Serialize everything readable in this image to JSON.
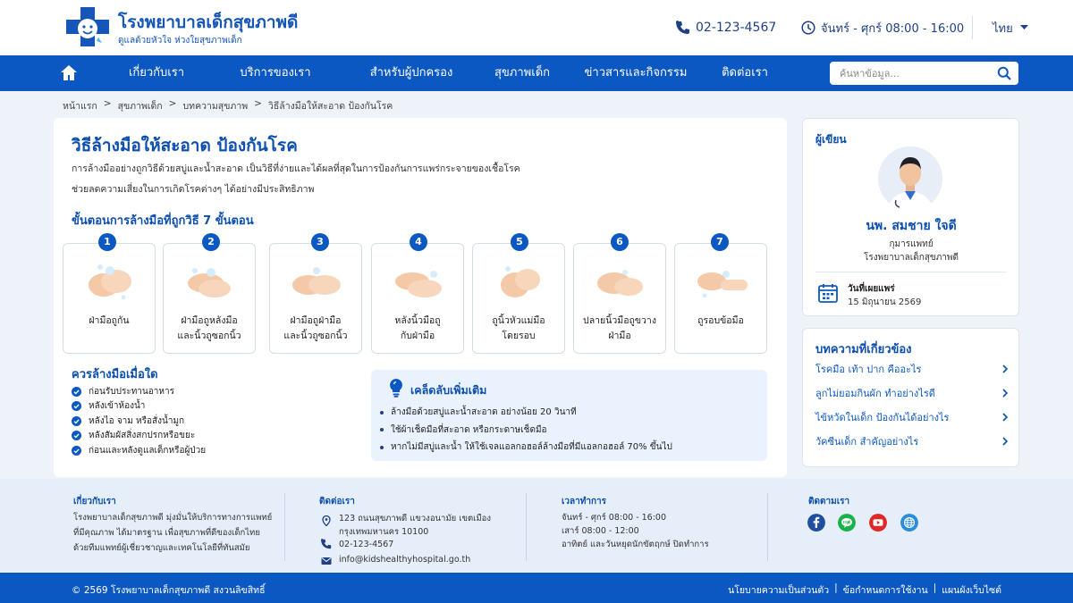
{
  "header": {
    "logo_title": "โรงพยาบาลเด็กสุขภาพดี",
    "logo_subtitle": "ดูแลด้วยหัวใจ ห่วงใยสุขภาพเด็ก",
    "phone": "02-123-4567",
    "hours": "จันทร์ - ศุกร์ 08:00 - 16:00",
    "language": "ไทย"
  },
  "nav": {
    "items": [
      "เกี่ยวกับเรา",
      "บริการของเรา",
      "สำหรับผู้ปกครอง",
      "สุขภาพเด็ก",
      "ข่าวสารและกิจกรรม",
      "ติดต่อเรา"
    ],
    "search_placeholder": "ค้นหาข้อมูล..."
  },
  "breadcrumb": [
    "หน้าแรก",
    "สุขภาพเด็ก",
    "บทความสุขภาพ",
    "วิธีล้างมือให้สะอาด ป้องกันโรค"
  ],
  "article": {
    "title": "วิธีล้างมือให้สะอาด ป้องกันโรค",
    "intro_line1": "การล้างมืออย่างถูกวิธีด้วยสบู่และน้ำสะอาด เป็นวิธีที่ง่ายและได้ผลที่สุดในการป้องกันการแพร่กระจายของเชื้อโรค",
    "intro_line2": "ช่วยลดความเสี่ยงในการเกิดโรคต่างๆ ได้อย่างมีประสิทธิภาพ",
    "steps_heading": "ขั้นตอนการล้างมือที่ถูกวิธี 7 ขั้นตอน",
    "steps": [
      {
        "num": "1",
        "line1": "ฝ่ามือถูกัน",
        "line2": ""
      },
      {
        "num": "2",
        "line1": "ฝ่ามือถูหลังมือ",
        "line2": "และนิ้วถูซอกนิ้ว"
      },
      {
        "num": "3",
        "line1": "ฝ่ามือถูฝ่ามือ",
        "line2": "และนิ้วถูซอกนิ้ว"
      },
      {
        "num": "4",
        "line1": "หลังนิ้วมือถู",
        "line2": "กับฝ่ามือ"
      },
      {
        "num": "5",
        "line1": "ถูนิ้วหัวแม่มือ",
        "line2": "โดยรอบ"
      },
      {
        "num": "6",
        "line1": "ปลายนิ้วมือถูขวาง",
        "line2": "ฝ่ามือ"
      },
      {
        "num": "7",
        "line1": "ถูรอบข้อมือ",
        "line2": ""
      }
    ],
    "when_heading": "ควรล้างมือเมื่อใด",
    "when_items": [
      "ก่อนรับประทานอาหาร",
      "หลังเข้าห้องน้ำ",
      "หลังไอ จาม หรือสั่งน้ำมูก",
      "หลังสัมผัสสิ่งสกปรกหรือขยะ",
      "ก่อนและหลังดูแลเด็กหรือผู้ป่วย"
    ],
    "tips_title": "เคล็ดลับเพิ่มเติม",
    "tips_items": [
      "ล้างมือด้วยสบู่และน้ำสะอาด อย่างน้อย 20 วินาที",
      "ใช้ผ้าเช็ดมือที่สะอาด หรือกระดาษเช็ดมือ",
      "หากไม่มีสบู่และน้ำ ให้ใช้เจลแอลกอฮอล์ล้างมือที่มีแอลกอฮอล์ 70% ขึ้นไป"
    ]
  },
  "author": {
    "heading": "ผู้เขียน",
    "name": "นพ. สมชาย ใจดี",
    "role": "กุมารแพทย์",
    "org": "โรงพยาบาลเด็กสุขภาพดี",
    "published_label": "วันที่เผยแพร่",
    "published_date": "15 มิถุนายน 2569"
  },
  "related": {
    "heading": "บทความที่เกี่ยวข้อง",
    "items": [
      "โรคมือ เท้า ปาก คืออะไร",
      "ลูกไม่ยอมกินผัก ทำอย่างไรดี",
      "ไข้หวัดในเด็ก ป้องกันได้อย่างไร",
      "วัคซีนเด็ก สำคัญอย่างไร"
    ]
  },
  "footer": {
    "about_heading": "เกี่ยวกับเรา",
    "about_lines": [
      "โรงพยาบาลเด็กสุขภาพดี มุ่งมั่นให้บริการทางการแพทย์",
      "ที่มีคุณภาพ ได้มาตรฐาน เพื่อสุขภาพที่ดีของเด็กไทย",
      "ด้วยทีมแพทย์ผู้เชี่ยวชาญและเทคโนโลยีที่ทันสมัย"
    ],
    "contact_heading": "ติดต่อเรา",
    "address_line1": "123 ถนนสุขภาพดี แขวงอนามัย เขตเมือง",
    "address_line2": "กรุงเทพมหานคร 10100",
    "phone": "02-123-4567",
    "email": "info@kidshealthyhospital.go.th",
    "hours_heading": "เวลาทำการ",
    "hours_lines": [
      "จันทร์ - ศุกร์ 08:00 - 16:00",
      "เสาร์ 08:00 - 12:00",
      "อาทิตย์ และวันหยุดนักขัตฤกษ์ ปิดทำการ"
    ],
    "follow_heading": "ติดตามเรา",
    "copyright": "© 2569 โรงพยาบาลเด็กสุขภาพดี สงวนลิขสิทธิ์",
    "links": [
      "นโยบายความเป็นส่วนตัว",
      "ข้อกำหนดการใช้งาน",
      "แผนผังเว็บไซต์"
    ],
    "link_separator": "|"
  },
  "colors": {
    "primary": "#0c58c2",
    "heading": "#0d4fae",
    "background": "#eef3fa",
    "tips_bg": "#eaf2fd"
  }
}
